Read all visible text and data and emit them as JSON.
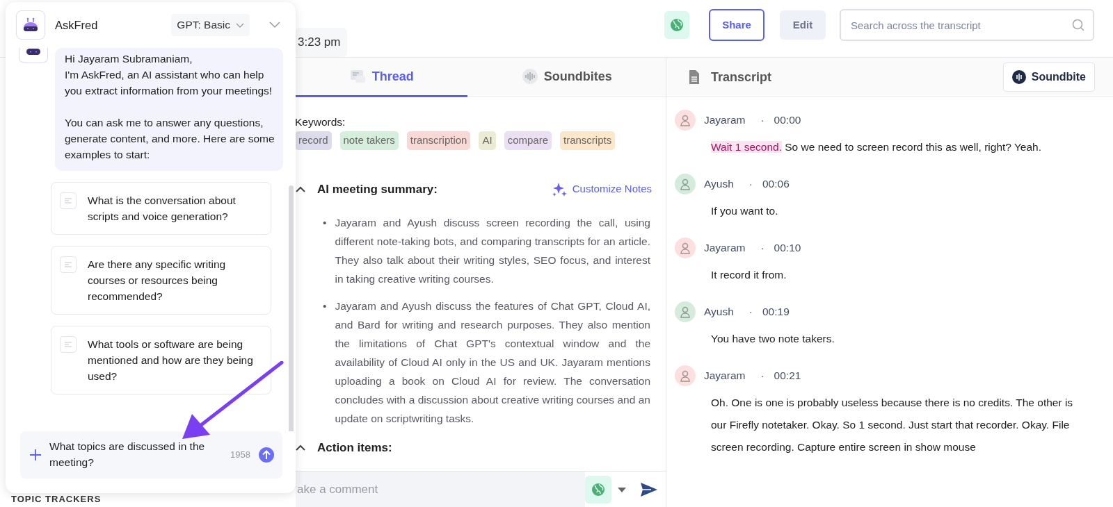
{
  "header": {
    "time": "3:23 pm",
    "share": "Share",
    "edit": "Edit",
    "search": {
      "placeholder": "Search across the transcript"
    }
  },
  "sidebar": {
    "section_label": "TOPIC TRACKERS"
  },
  "tabs": [
    {
      "label": "Thread",
      "selected": true,
      "kind": "thread"
    },
    {
      "label": "Soundbites",
      "selected": false,
      "kind": "soundbites"
    }
  ],
  "thread": {
    "keywords_label": "Keywords:",
    "keywords": [
      {
        "label": "record",
        "color": "#dcdcec"
      },
      {
        "label": "note takers",
        "color": "#d6eedc"
      },
      {
        "label": "transcription",
        "color": "#f9d9d6"
      },
      {
        "label": "AI",
        "color": "#ecebd6"
      },
      {
        "label": "compare",
        "color": "#ebdff3"
      },
      {
        "label": "transcripts",
        "color": "#fde7cb"
      }
    ],
    "summary": {
      "title": "AI meeting summary:",
      "expanded": true,
      "customize": "Customize Notes",
      "bullets": [
        {
          "marker": "•",
          "text": "Jayaram and Ayush discuss screen recording the call, using different note-taking bots, and comparing transcripts for an article. They also talk about their writing styles, SEO focus, and interest in taking creative writing courses."
        },
        {
          "marker": "•",
          "text": "Jayaram and Ayush discuss the features of Chat GPT, Cloud AI, and Bard for writing and research purposes. They also mention the limitations of Chat GPT's contextual window and the availability of Cloud AI only in the US and UK. Jayaram mentions uploading a book on Cloud AI for review. The conversation concludes with a discussion about creative writing courses and an update on scriptwriting tasks."
        }
      ]
    },
    "action_items": {
      "title": "Action items:",
      "expanded": true
    },
    "comment": {
      "placeholder": "ake a comment"
    }
  },
  "transcript": {
    "title": "Transcript",
    "soundbite_button": "Soundbite",
    "entries": [
      {
        "speaker": "Jayaram",
        "color": "#fbe0df",
        "separator": "·",
        "time": "00:00",
        "highlight": "Wait 1 second.",
        "text": "So we need to screen record this as well, right? Yeah."
      },
      {
        "speaker": "Ayush",
        "color": "#d5ecdc",
        "separator": "·",
        "time": "00:06",
        "text": "If you want to."
      },
      {
        "speaker": "Jayaram",
        "color": "#fbe0df",
        "separator": "·",
        "time": "00:10",
        "text": "It record it from."
      },
      {
        "speaker": "Ayush",
        "color": "#d5ecdc",
        "separator": "·",
        "time": "00:19",
        "text": "You have two note takers."
      },
      {
        "speaker": "Jayaram",
        "color": "#fbe0df",
        "separator": "·",
        "time": "00:21",
        "text": "Oh. One is one is probably useless because there is no credits. The other is our Firefly notetaker. Okay. So 1 second. Just start that recorder. Okay. File screen recording. Capture entire screen in show mouse"
      }
    ]
  },
  "askfred": {
    "title": "AskFred",
    "model": "GPT: Basic",
    "greeting": "Hi Jayaram Subramaniam,\nI'm AskFred, an AI assistant who can help you extract information from your meetings!\n\nYou can ask me to answer any questions, generate content, and more. Here are some examples to start:",
    "suggestions": [
      "What is the conversation about scripts and voice generation?",
      "Are there any specific writing courses or resources being recommended?",
      "What tools or software are being mentioned and how are they being used?"
    ],
    "input": {
      "value": "What topics are discussed in the meeting?",
      "count": "1958"
    }
  }
}
